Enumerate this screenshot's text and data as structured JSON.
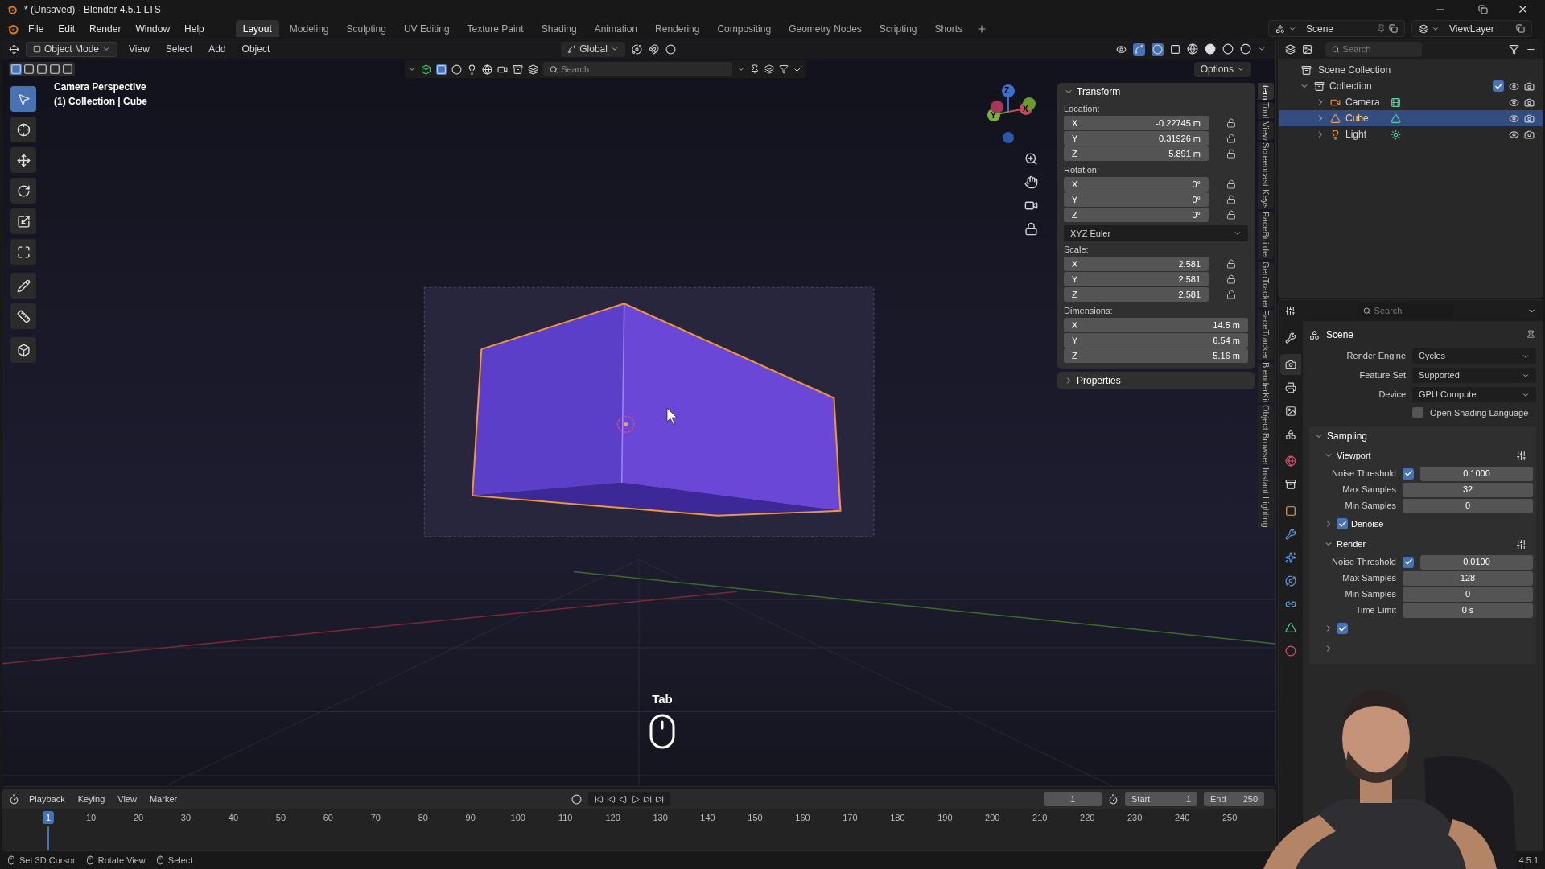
{
  "window": {
    "title": "* (Unsaved) - Blender 4.5.1 LTS"
  },
  "menu": [
    "File",
    "Edit",
    "Render",
    "Window",
    "Help"
  ],
  "workspaces": [
    {
      "label": "Layout",
      "selected": true
    },
    {
      "label": "Modeling",
      "selected": false
    },
    {
      "label": "Sculpting",
      "selected": false
    },
    {
      "label": "UV Editing",
      "selected": false
    },
    {
      "label": "Texture Paint",
      "selected": false
    },
    {
      "label": "Shading",
      "selected": false
    },
    {
      "label": "Animation",
      "selected": false
    },
    {
      "label": "Rendering",
      "selected": false
    },
    {
      "label": "Compositing",
      "selected": false
    },
    {
      "label": "Geometry Nodes",
      "selected": false
    },
    {
      "label": "Scripting",
      "selected": false
    },
    {
      "label": "Shorts",
      "selected": false
    }
  ],
  "scene": "Scene",
  "view_layer": "ViewLayer",
  "viewport": {
    "mode": "Object Mode",
    "menus": [
      "View",
      "Select",
      "Add",
      "Object"
    ],
    "orientation": "Global",
    "search_placeholder": "Search",
    "options": "Options",
    "overlay_title": "Camera Perspective",
    "overlay_subtitle": "(1) Collection | Cube",
    "gizmo_axes": [
      "Z",
      "Y",
      "X"
    ],
    "key_display": "Tab"
  },
  "tools": [
    {
      "kind": "select",
      "selected": true
    },
    {
      "kind": "cursor",
      "selected": false
    },
    {
      "kind": "move",
      "selected": false
    },
    {
      "kind": "rotate",
      "selected": false
    },
    {
      "kind": "scale",
      "selected": false
    },
    {
      "kind": "transform",
      "selected": false
    },
    {
      "kind": "annotate",
      "selected": false
    },
    {
      "kind": "measure",
      "selected": false
    },
    {
      "kind": "add",
      "selected": false
    }
  ],
  "transform": {
    "title": "Transform",
    "expanded": true,
    "items": [
      {
        "kind": "fields",
        "label": "Location:",
        "rows": [
          {
            "axis": "X",
            "value": "-0.22745 m",
            "locked": false
          },
          {
            "axis": "Y",
            "value": "0.31926 m",
            "locked": false
          },
          {
            "axis": "Z",
            "value": "5.891 m",
            "locked": false
          }
        ]
      },
      {
        "kind": "fields",
        "label": "Rotation:",
        "rows": [
          {
            "axis": "X",
            "value": "0°",
            "locked": false
          },
          {
            "axis": "Y",
            "value": "0°",
            "locked": false
          },
          {
            "axis": "Z",
            "value": "0°",
            "locked": false
          }
        ]
      },
      {
        "kind": "dropdown",
        "value": "XYZ Euler"
      },
      {
        "kind": "fields",
        "label": "Scale:",
        "rows": [
          {
            "axis": "X",
            "value": "2.581",
            "locked": false
          },
          {
            "axis": "Y",
            "value": "2.581",
            "locked": false
          },
          {
            "axis": "Z",
            "value": "2.581",
            "locked": false
          }
        ]
      },
      {
        "kind": "fields",
        "label": "Dimensions:",
        "rows": [
          {
            "axis": "X",
            "value": "14.5 m"
          },
          {
            "axis": "Y",
            "value": "6.54 m"
          },
          {
            "axis": "Z",
            "value": "5.16 m"
          }
        ]
      }
    ]
  },
  "properties_panel": {
    "title": "Properties",
    "expanded": false
  },
  "sidebar_tabs": [
    {
      "label": "Item",
      "selected": true
    },
    {
      "label": "Tool",
      "selected": false
    },
    {
      "label": "View",
      "selected": false
    },
    {
      "label": "Screencast Keys",
      "selected": false
    },
    {
      "label": "FaceBuilder",
      "selected": false
    },
    {
      "label": "GeoTracker",
      "selected": false
    },
    {
      "label": "FaceTracker",
      "selected": false
    },
    {
      "label": "BlenderKit",
      "selected": false
    },
    {
      "label": "Object Browser",
      "selected": false
    },
    {
      "label": "Instant Lighting",
      "selected": false
    }
  ],
  "outliner": {
    "search_placeholder": "Search",
    "root": "Scene Collection",
    "collection": {
      "label": "Collection",
      "expanded": true,
      "checked": true
    },
    "items": [
      {
        "label": "Camera",
        "kind": "camera",
        "selected": false
      },
      {
        "label": "Cube",
        "kind": "mesh",
        "selected": true
      },
      {
        "label": "Light",
        "kind": "light",
        "selected": false
      }
    ]
  },
  "properties": {
    "search_placeholder": "Search",
    "context": "Scene",
    "tabs": [
      {
        "kind": "tool",
        "selected": false
      },
      {
        "kind": "render",
        "selected": true
      },
      {
        "kind": "output",
        "selected": false
      },
      {
        "kind": "view_layer",
        "selected": false
      },
      {
        "kind": "scene",
        "selected": false
      },
      {
        "kind": "world",
        "selected": false
      },
      {
        "kind": "collection",
        "selected": false
      },
      {
        "kind": "object",
        "selected": false
      },
      {
        "kind": "modifier",
        "selected": false
      },
      {
        "kind": "particles",
        "selected": false
      },
      {
        "kind": "physics",
        "selected": false
      },
      {
        "kind": "constraints",
        "selected": false
      },
      {
        "kind": "data",
        "selected": false
      },
      {
        "kind": "material",
        "selected": false
      }
    ],
    "fields": [
      {
        "label": "Render Engine",
        "value": "Cycles"
      },
      {
        "label": "Feature Set",
        "value": "Supported"
      },
      {
        "label": "Device",
        "value": "GPU Compute"
      }
    ],
    "osl": {
      "label": "Open Shading Language",
      "checked": false
    },
    "sampling": {
      "title": "Sampling",
      "expanded": true,
      "subpanels": [
        {
          "title": "Viewport",
          "expanded": true,
          "rows": [
            {
              "kind": "threshold",
              "label": "Noise Threshold",
              "checked": true,
              "value": "0.1000"
            },
            {
              "kind": "number",
              "label": "Max Samples",
              "value": "32"
            },
            {
              "kind": "number",
              "label": "Min Samples",
              "value": "0"
            }
          ]
        },
        {
          "title": "Denoise",
          "expanded": false,
          "checked": true
        },
        {
          "title": "Render",
          "expanded": true,
          "rows": [
            {
              "kind": "threshold",
              "label": "Noise Threshold",
              "checked": true,
              "value": "0.0100"
            },
            {
              "kind": "number",
              "label": "Max Samples",
              "value": "128"
            },
            {
              "kind": "number",
              "label": "Min Samples",
              "value": "0"
            },
            {
              "kind": "number",
              "label": "Time Limit",
              "value": "0 s"
            }
          ]
        }
      ],
      "covered_rows": [
        {
          "expanded": false,
          "checked": true
        },
        {
          "expanded": false
        }
      ]
    }
  },
  "timeline": {
    "menus": [
      "Playback",
      "Keying",
      "View",
      "Marker"
    ],
    "current_frame": "1",
    "start_label": "Start",
    "start": "1",
    "end_label": "End",
    "end": "250",
    "ruler": [
      {
        "label": "1",
        "selected": true
      },
      {
        "label": "10",
        "selected": false
      },
      {
        "label": "20",
        "selected": false
      },
      {
        "label": "30",
        "selected": false
      },
      {
        "label": "40",
        "selected": false
      },
      {
        "label": "50",
        "selected": false
      },
      {
        "label": "60",
        "selected": false
      },
      {
        "label": "70",
        "selected": false
      },
      {
        "label": "80",
        "selected": false
      },
      {
        "label": "90",
        "selected": false
      },
      {
        "label": "100",
        "selected": false
      },
      {
        "label": "110",
        "selected": false
      },
      {
        "label": "120",
        "selected": false
      },
      {
        "label": "130",
        "selected": false
      },
      {
        "label": "140",
        "selected": false
      },
      {
        "label": "150",
        "selected": false
      },
      {
        "label": "160",
        "selected": false
      },
      {
        "label": "170",
        "selected": false
      },
      {
        "label": "180",
        "selected": false
      },
      {
        "label": "190",
        "selected": false
      },
      {
        "label": "200",
        "selected": false
      },
      {
        "label": "210",
        "selected": false
      },
      {
        "label": "220",
        "selected": false
      },
      {
        "label": "230",
        "selected": false
      },
      {
        "label": "240",
        "selected": false
      },
      {
        "label": "250",
        "selected": false
      }
    ]
  },
  "status_bar": {
    "hints": [
      "Set 3D Cursor",
      "Rotate View",
      "Select"
    ],
    "version": "4.5.1"
  }
}
